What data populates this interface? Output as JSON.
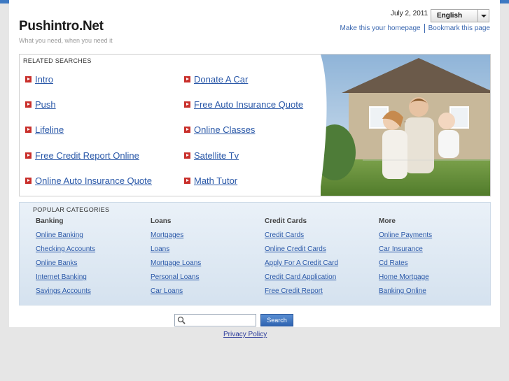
{
  "header": {
    "site_title": "Pushintro.Net",
    "tagline": "What you need, when you need it",
    "date": "July 2, 2011",
    "language_selected": "English",
    "link_homepage": "Make this your homepage",
    "link_bookmark": "Bookmark this page"
  },
  "related": {
    "heading": "RELATED SEARCHES",
    "left": [
      "Intro",
      "Push",
      "Lifeline",
      "Free Credit Report Online",
      "Online Auto Insurance Quote"
    ],
    "right": [
      "Donate A Car",
      "Free Auto Insurance Quote",
      "Online Classes",
      "Satellite Tv",
      "Math Tutor"
    ]
  },
  "categories": {
    "heading": "POPULAR CATEGORIES",
    "columns": [
      {
        "title": "Banking",
        "links": [
          "Online Banking",
          "Checking Accounts",
          "Online Banks",
          "Internet Banking",
          "Savings Accounts"
        ]
      },
      {
        "title": "Loans",
        "links": [
          "Mortgages",
          "Loans",
          "Mortgage Loans",
          "Personal Loans",
          "Car Loans"
        ]
      },
      {
        "title": "Credit Cards",
        "links": [
          "Credit Cards",
          "Online Credit Cards",
          "Apply For A Credit Card",
          "Credit Card Application",
          "Free Credit Report"
        ]
      },
      {
        "title": "More",
        "links": [
          "Online Payments",
          "Car Insurance",
          "Cd Rates",
          "Home Mortgage",
          "Banking Online"
        ]
      }
    ]
  },
  "search": {
    "button_label": "Search",
    "value": ""
  },
  "footer": {
    "privacy_label": "Privacy Policy"
  },
  "colors": {
    "topbar": "#3d79c2",
    "link": "#2a58a8",
    "bullet": "#c9302c"
  }
}
